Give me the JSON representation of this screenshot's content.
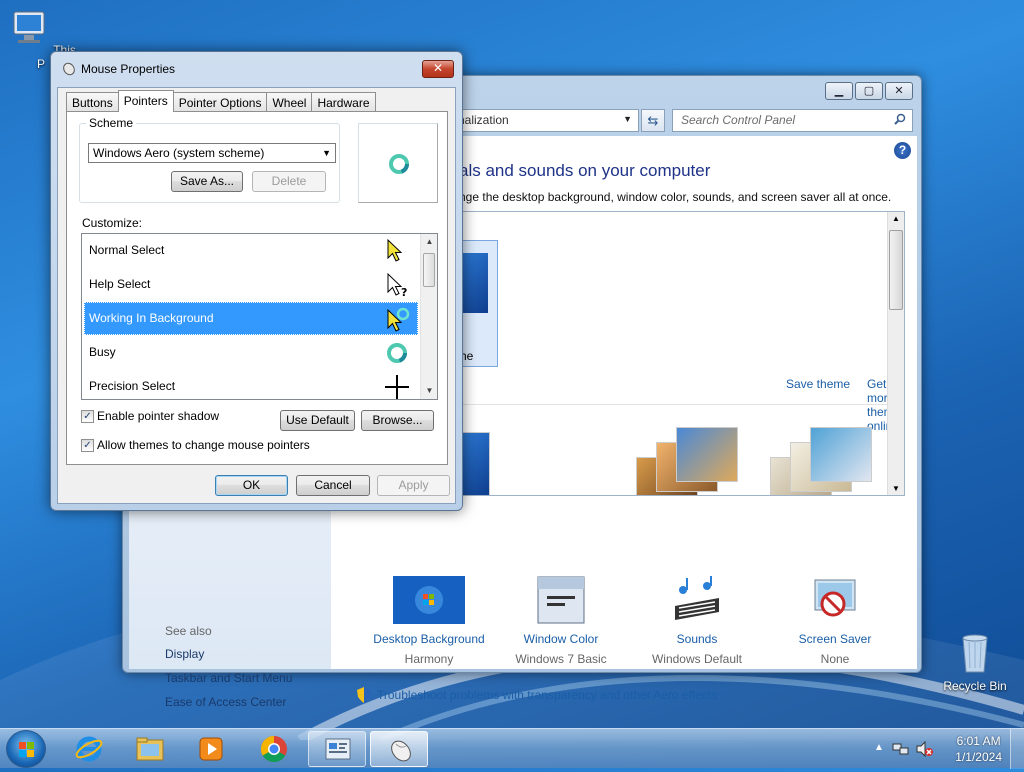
{
  "desktop": {
    "this_pc_label": "This P",
    "recycle_bin_label": "Recycle Bin"
  },
  "control_panel": {
    "address_text": "nalization",
    "search_placeholder": "Search Control Panel",
    "heading": "als and sounds on your computer",
    "subheading": "nge the desktop background, window color, sounds, and screen saver all at once.",
    "selected_theme_name_fragment": "he",
    "save_theme": "Save theme",
    "get_more_themes": "Get more themes online",
    "see_also": {
      "header": "See also",
      "items": [
        "Display",
        "Taskbar and Start Menu",
        "Ease of Access Center"
      ]
    },
    "bottom_items": [
      {
        "label": "Desktop Background",
        "value": "Harmony",
        "icon": "desktop-background-icon"
      },
      {
        "label": "Window Color",
        "value": "Windows 7 Basic",
        "icon": "window-color-icon"
      },
      {
        "label": "Sounds",
        "value": "Windows Default",
        "icon": "sounds-icon"
      },
      {
        "label": "Screen Saver",
        "value": "None",
        "icon": "screen-saver-icon"
      }
    ],
    "troubleshoot": "Troubleshoot problems with transparency and other Aero effects"
  },
  "dialog": {
    "title": "Mouse Properties",
    "close": "✕",
    "tabs": [
      "Buttons",
      "Pointers",
      "Pointer Options",
      "Wheel",
      "Hardware"
    ],
    "active_tab": "Pointers",
    "scheme_label": "Scheme",
    "scheme_value": "Windows Aero (system scheme)",
    "save_as": "Save As...",
    "delete": "Delete",
    "customize_label": "Customize:",
    "pointers": [
      {
        "name": "Normal Select",
        "cursor": "arrow-yellow"
      },
      {
        "name": "Help Select",
        "cursor": "help"
      },
      {
        "name": "Working In Background",
        "cursor": "working"
      },
      {
        "name": "Busy",
        "cursor": "busy"
      },
      {
        "name": "Precision Select",
        "cursor": "crosshair"
      }
    ],
    "selected_pointer": "Working In Background",
    "enable_shadow": "Enable pointer shadow",
    "enable_shadow_checked": true,
    "allow_themes": "Allow themes to change mouse pointers",
    "allow_themes_checked": true,
    "use_default": "Use Default",
    "browse": "Browse...",
    "ok": "OK",
    "cancel": "Cancel",
    "apply": "Apply"
  },
  "taskbar": {
    "time": "6:01 AM",
    "date": "1/1/2024",
    "pinned": [
      "internet-explorer-icon",
      "file-explorer-icon",
      "media-player-icon",
      "chrome-icon",
      "control-panel-icon",
      "mouse-properties-icon"
    ]
  },
  "colors": {
    "selection": "#3399ff",
    "link": "#1a5ea7",
    "heading": "#1e3287"
  }
}
